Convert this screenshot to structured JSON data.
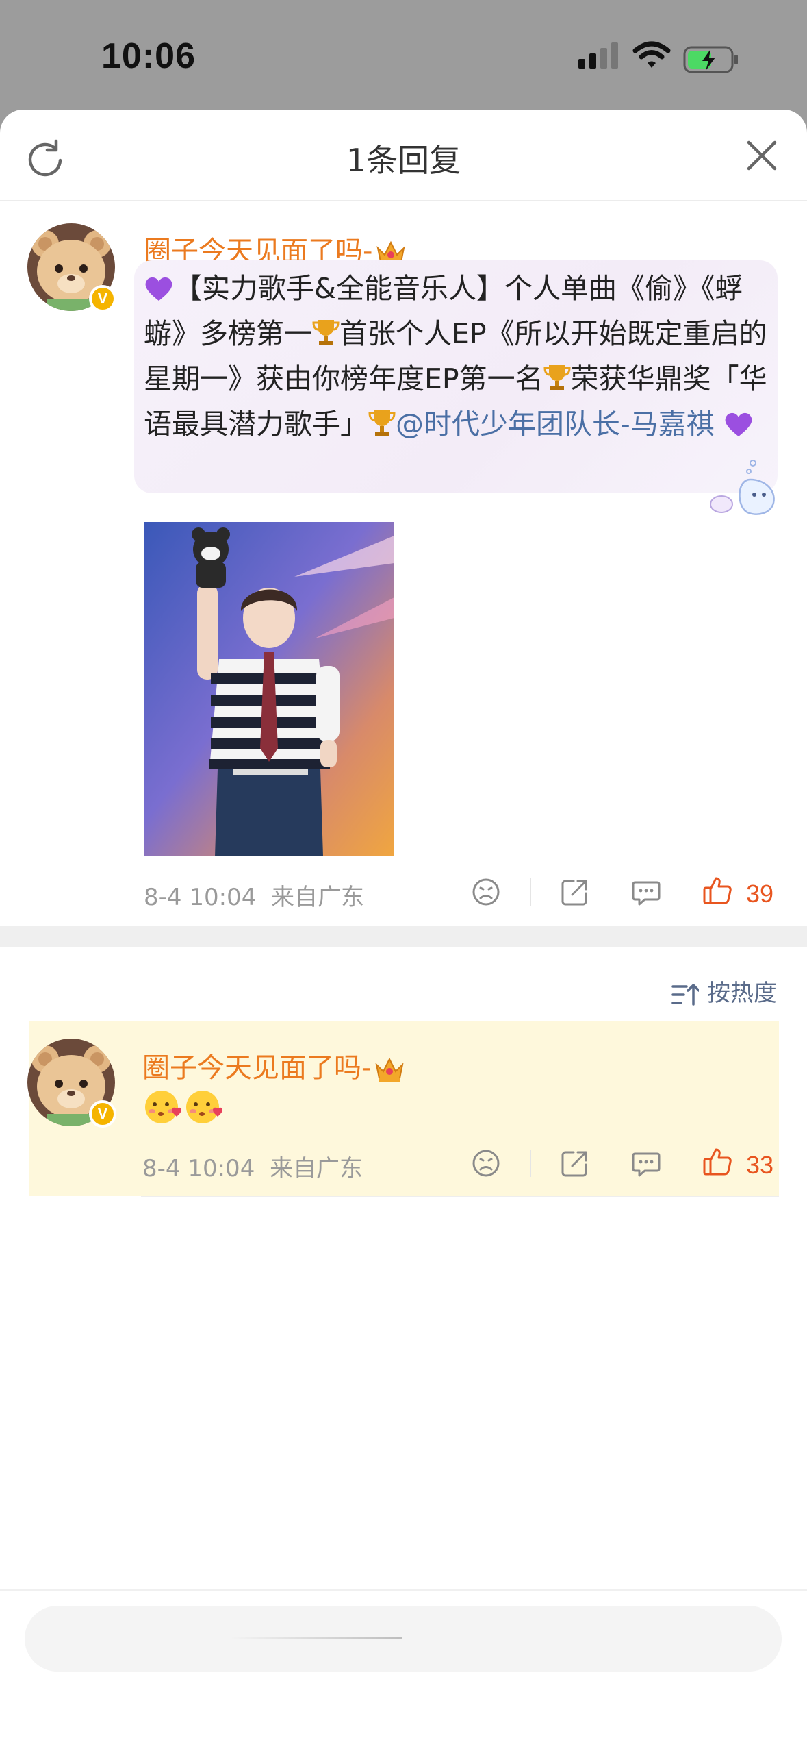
{
  "status_bar": {
    "time": "10:06"
  },
  "sheet": {
    "title": "1条回复"
  },
  "root_comment": {
    "username": "圈子今天见面了吗-",
    "text_plain": "【实力歌手&全能音乐人】个人单曲《偷》《蜉蝣》多榜第一",
    "text_part2": "首张个人EP《所以开始既定重启的星期一》获由你榜年度EP第一名",
    "text_part3": "荣获华鼎奖「华语最具潜力歌手」",
    "mention": "@时代少年团队长-马嘉祺",
    "timestamp": "8-4 10:04",
    "location": "来自广东",
    "like_count": "39"
  },
  "sort": {
    "label": "按热度"
  },
  "reply": {
    "username": "圈子今天见面了吗-",
    "timestamp": "8-4 10:04",
    "location": "来自广东",
    "like_count": "33"
  },
  "icons": {
    "refresh": "refresh-icon",
    "close": "close-icon",
    "dislike": "frown-face-icon",
    "share": "share-icon",
    "comment": "comment-icon",
    "like": "thumbs-up-icon",
    "sort": "sort-icon"
  },
  "colors": {
    "username": "#eb7a1f",
    "like": "#e8551f",
    "mention": "#4a6fa5",
    "reply_highlight": "#fef8dc"
  }
}
